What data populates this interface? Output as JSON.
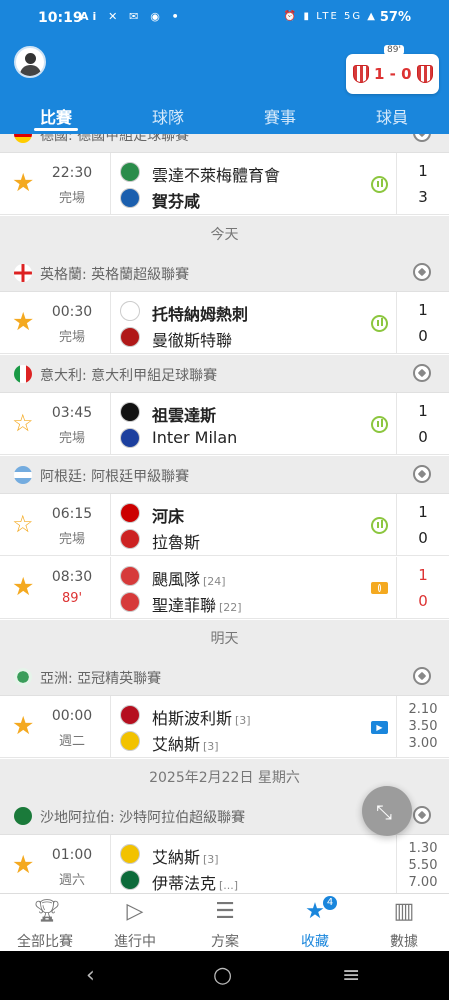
{
  "status_bar": {
    "time": "10:19",
    "left_icons": "Ai ✕ ✉ ◉ •",
    "right_icons": "⏰ ▮ LTE 5G ▲",
    "battery": "57%"
  },
  "header": {
    "live_card": {
      "minute": "89'",
      "score": "1 - 0"
    },
    "tabs": [
      {
        "label": "比賽",
        "active": true
      },
      {
        "label": "球隊"
      },
      {
        "label": "賽事"
      },
      {
        "label": "球員"
      }
    ]
  },
  "sections": [
    {
      "type": "league",
      "name": "德國: 德國甲組足球聯賽",
      "flag": "germany"
    },
    {
      "type": "match",
      "starred": true,
      "time": "22:30",
      "status": "完場",
      "home": "雲達不萊梅體育會",
      "away": "賀芬咸",
      "home_bold": false,
      "away_bold": true,
      "home_score": "1",
      "away_score": "3",
      "indicator": "stats"
    },
    {
      "type": "date",
      "label": "今天"
    },
    {
      "type": "league",
      "name": "英格蘭: 英格蘭超級聯賽",
      "flag": "england"
    },
    {
      "type": "match",
      "starred": true,
      "time": "00:30",
      "status": "完場",
      "home": "托特納姆熱刺",
      "away": "曼徹斯特聯",
      "home_bold": true,
      "away_bold": false,
      "home_score": "1",
      "away_score": "0",
      "indicator": "stats"
    },
    {
      "type": "league",
      "name": "意大利: 意大利甲組足球聯賽",
      "flag": "italy"
    },
    {
      "type": "match",
      "starred": false,
      "time": "03:45",
      "status": "完場",
      "home": "祖雲達斯",
      "away": "Inter Milan",
      "home_bold": true,
      "away_bold": false,
      "home_score": "1",
      "away_score": "0",
      "indicator": "stats"
    },
    {
      "type": "league",
      "name": "阿根廷: 阿根廷甲級聯賽",
      "flag": "argentina"
    },
    {
      "type": "match",
      "starred": false,
      "time": "06:15",
      "status": "完場",
      "home": "河床",
      "away": "拉魯斯",
      "home_bold": true,
      "away_bold": false,
      "home_score": "1",
      "away_score": "0",
      "indicator": "stats"
    },
    {
      "type": "match",
      "starred": true,
      "time": "08:30",
      "status": "89'",
      "live": true,
      "home": "颶風隊",
      "home_rank": "[24]",
      "away": "聖達菲聯",
      "away_rank": "[22]",
      "home_score": "1",
      "away_score": "0",
      "indicator": "pitch"
    },
    {
      "type": "date",
      "label": "明天"
    },
    {
      "type": "league",
      "name": "亞洲: 亞冠精英聯賽",
      "flag": "asia"
    },
    {
      "type": "match",
      "starred": true,
      "time": "00:00",
      "status": "週二",
      "home": "柏斯波利斯",
      "home_rank": "[3]",
      "away": "艾納斯",
      "away_rank": "[3]",
      "odds": [
        "2.10",
        "3.50",
        "3.00"
      ],
      "indicator": "video"
    },
    {
      "type": "date",
      "label": "2025年2月22日 星期六"
    },
    {
      "type": "league",
      "name": "沙地阿拉伯: 沙特阿拉伯超級聯賽",
      "flag": "saudi"
    },
    {
      "type": "match",
      "starred": true,
      "time": "01:00",
      "status": "週六",
      "home": "艾納斯",
      "home_rank": "[3]",
      "away": "伊蒂法克",
      "away_rank": "[...]",
      "odds": [
        "1.30",
        "5.50",
        "7.00"
      ],
      "indicator": "none"
    }
  ],
  "bottom_nav": [
    {
      "label": "全部比賽",
      "icon": "trophy-icon"
    },
    {
      "label": "進行中",
      "icon": "play-icon"
    },
    {
      "label": "方案",
      "icon": "document-icon"
    },
    {
      "label": "收藏",
      "icon": "star-icon",
      "active": true,
      "count": "4"
    },
    {
      "label": "數據",
      "icon": "chart-icon"
    }
  ],
  "colors": {
    "accent": "#1a86dc",
    "star": "#f4a920",
    "live": "#dd3333"
  }
}
